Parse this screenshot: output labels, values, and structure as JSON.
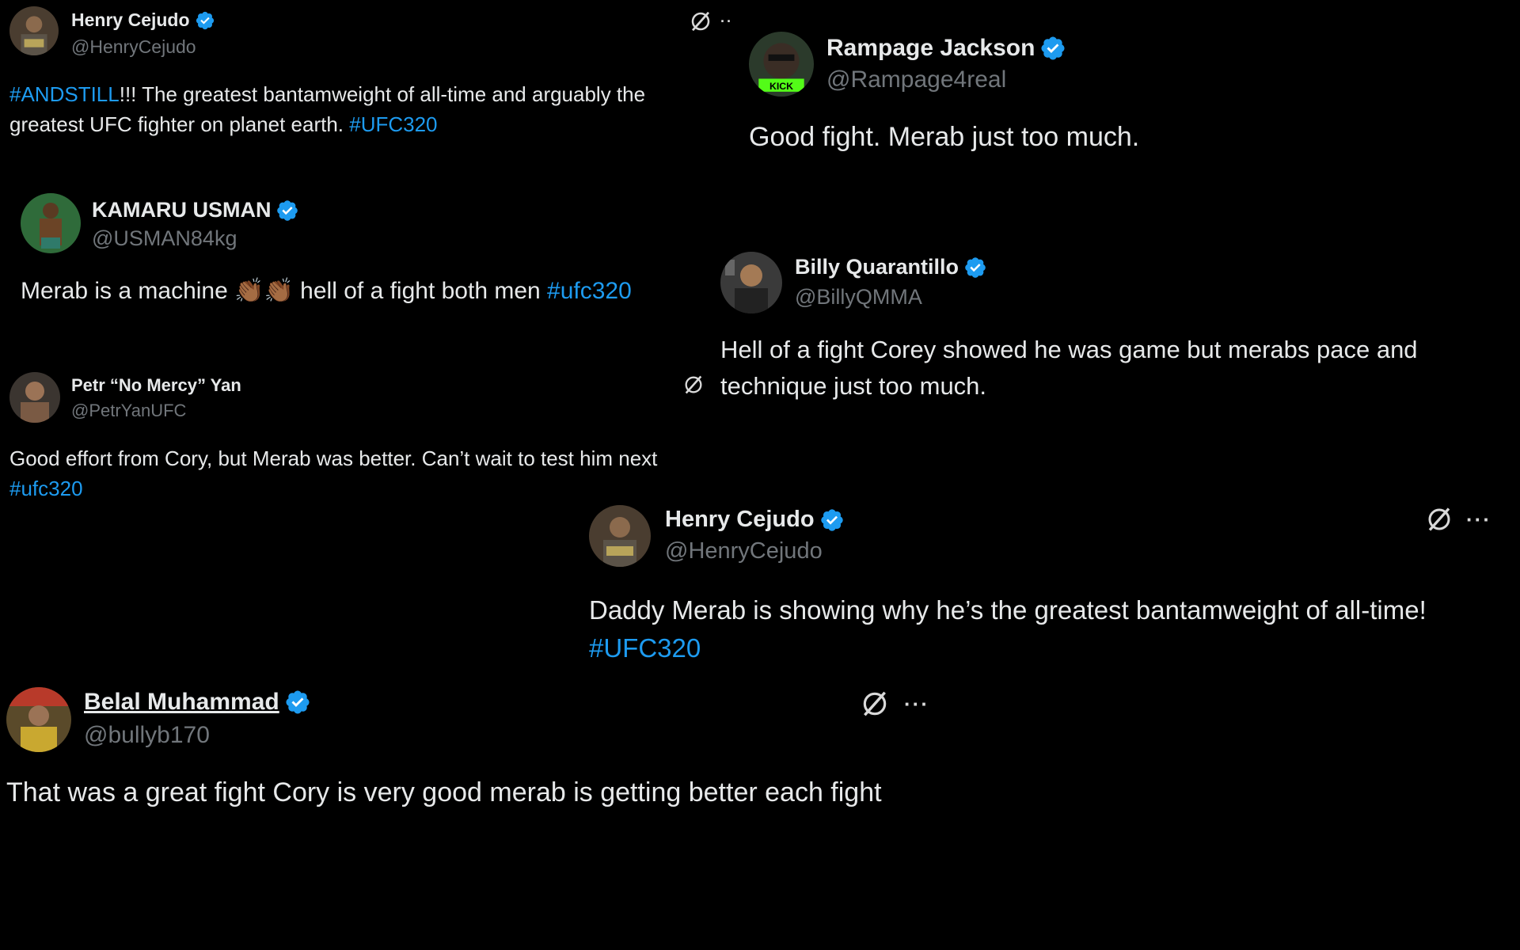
{
  "colors": {
    "background": "#000000",
    "text": "#e7e9ea",
    "handle": "#71767b",
    "hashtag": "#1d9bf0",
    "verified": "#1d9bf0"
  },
  "icons": {
    "verified": "verified-badge-icon",
    "grok": "grok-icon",
    "more": "more-options-icon"
  },
  "tweets": [
    {
      "name": "Henry Cejudo",
      "handle": "@HenryCejudo",
      "hashtag1": "#ANDSTILL",
      "text1": "!!! The greatest bantamweight of all-time and arguably the",
      "text2": "greatest UFC fighter on planet earth. ",
      "hashtag2": "#UFC320",
      "more": "··"
    },
    {
      "name": "Rampage Jackson",
      "handle": "@Rampage4real",
      "avatar_label": "KICK",
      "text": "Good fight. Merab just too much."
    },
    {
      "name": "KAMARU USMAN",
      "handle": "@USMAN84kg",
      "text": "Merab is a machine ",
      "emoji": "👏🏾👏🏾",
      "text2": " hell of a fight both men  ",
      "hashtag": "#ufc320"
    },
    {
      "name": "Billy Quarantillo",
      "handle": "@BillyQMMA",
      "text1": "Hell of a fight Corey  showed he was game but merabs pace and",
      "text2": "technique just too much."
    },
    {
      "name": "Petr “No Mercy” Yan",
      "handle": "@PetrYanUFC",
      "text1": "Good effort from Cory, but Merab was better. Can’t wait to test him next",
      "hashtag": "#ufc320"
    },
    {
      "name": "Henry Cejudo",
      "handle": "@HenryCejudo",
      "text1": "Daddy Merab is showing why he’s the greatest bantamweight of all-time!",
      "hashtag": "#UFC320",
      "more": "···"
    },
    {
      "name": "Belal Muhammad",
      "handle": "@bullyb170",
      "text": "That was a great fight Cory is very good merab is getting better each fight",
      "more": "···"
    }
  ]
}
